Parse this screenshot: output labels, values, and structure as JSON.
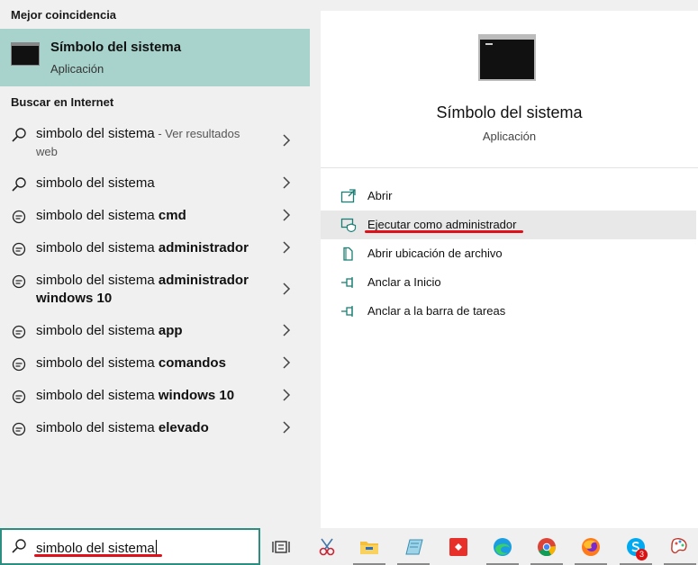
{
  "left": {
    "best_match_heading": "Mejor coincidencia",
    "best_match": {
      "title": "Símbolo del sistema",
      "type": "Aplicación"
    },
    "web_heading": "Buscar en Internet",
    "results": [
      {
        "query": "simbolo del sistema",
        "bold": "",
        "suffix": " - Ver resultados",
        "line2": "web",
        "icon": "search-icon"
      },
      {
        "query": "simbolo del sistema",
        "bold": "",
        "suffix": "",
        "line2": "",
        "icon": "search-icon"
      },
      {
        "query": "simbolo del sistema ",
        "bold": "cmd",
        "suffix": "",
        "line2": "",
        "icon": "chat-suggestion-icon"
      },
      {
        "query": "simbolo del sistema ",
        "bold": "administrador",
        "suffix": "",
        "line2": "",
        "icon": "chat-suggestion-icon"
      },
      {
        "query": "simbolo del sistema ",
        "bold": "administrador",
        "suffix": "",
        "line2": "windows 10",
        "icon": "chat-suggestion-icon"
      },
      {
        "query": "simbolo del sistema ",
        "bold": "app",
        "suffix": "",
        "line2": "",
        "icon": "chat-suggestion-icon"
      },
      {
        "query": "simbolo del sistema ",
        "bold": "comandos",
        "suffix": "",
        "line2": "",
        "icon": "chat-suggestion-icon"
      },
      {
        "query": "simbolo del sistema ",
        "bold": "windows 10",
        "suffix": "",
        "line2": "",
        "icon": "chat-suggestion-icon"
      },
      {
        "query": "simbolo del sistema ",
        "bold": "elevado",
        "suffix": "",
        "line2": "",
        "icon": "chat-suggestion-icon"
      }
    ]
  },
  "right": {
    "title": "Símbolo del sistema",
    "subtitle": "Aplicación",
    "actions": [
      {
        "label": "Abrir",
        "icon": "open-icon"
      },
      {
        "label": "Ejecutar como administrador",
        "icon": "shield-admin-icon"
      },
      {
        "label": "Abrir ubicación de archivo",
        "icon": "file-location-icon"
      },
      {
        "label": "Anclar a Inicio",
        "icon": "pin-icon"
      },
      {
        "label": "Anclar a la barra de tareas",
        "icon": "pin-icon"
      }
    ]
  },
  "search": {
    "value": "simbolo del sistema"
  },
  "taskbar": {
    "skype_badge": "3",
    "apps": [
      "task-view-icon",
      "snipping-icon",
      "file-explorer-icon",
      "notepad-icon",
      "anydesk-icon",
      "edge-icon",
      "chrome-icon",
      "firefox-icon",
      "skype-icon",
      "paint-icon"
    ]
  },
  "colors": {
    "accent": "#2b8e80",
    "selected_bg": "#a8d3cc",
    "annotation_red": "#e0101a"
  }
}
